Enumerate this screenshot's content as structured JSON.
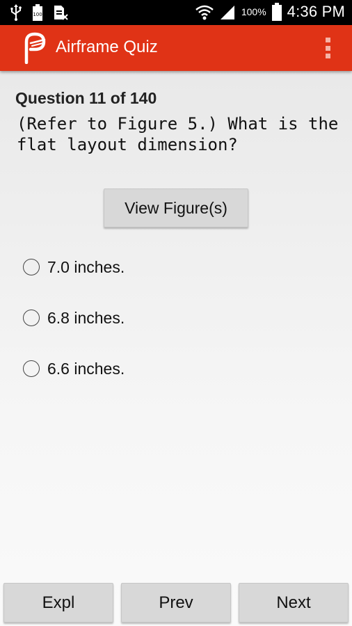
{
  "status_bar": {
    "battery_percent": "100%",
    "time": "4:36 PM",
    "icons": [
      "usb-icon",
      "battery-100-icon",
      "sim-icon",
      "wifi-icon",
      "signal-icon",
      "battery-icon"
    ]
  },
  "app_bar": {
    "title": "Airframe Quiz",
    "logo_icon": "app-logo-icon",
    "menu_icon": "overflow-menu-icon",
    "color": "#e03316"
  },
  "question": {
    "header": "Question 11 of 140",
    "text": "(Refer to Figure 5.) What is the flat layout dimension?"
  },
  "view_figure_label": "View Figure(s)",
  "options": [
    {
      "label": "7.0 inches.",
      "selected": false
    },
    {
      "label": "6.8 inches.",
      "selected": false
    },
    {
      "label": "6.6 inches.",
      "selected": false
    }
  ],
  "nav_buttons": {
    "expl": "Expl",
    "prev": "Prev",
    "next": "Next"
  }
}
